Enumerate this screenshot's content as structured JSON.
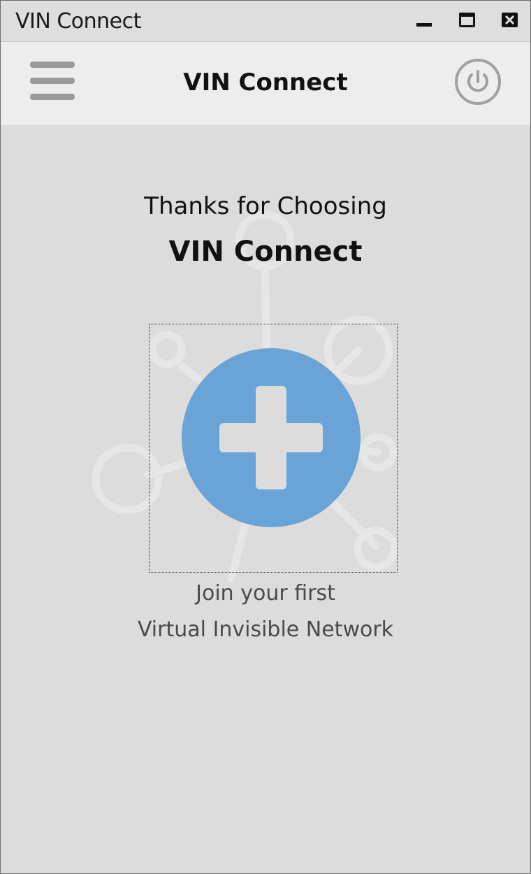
{
  "window": {
    "title": "VIN Connect",
    "controls": {
      "minimize": "minimize-icon",
      "maximize": "maximize-icon",
      "close": "close-icon"
    }
  },
  "header": {
    "title": "VIN Connect",
    "menu_icon": "hamburger-menu-icon",
    "power_icon": "power-icon"
  },
  "main": {
    "greeting": "Thanks for Choosing",
    "brand": "VIN Connect",
    "add_icon": "plus-circle-icon",
    "caption_line1": "Join your first",
    "caption_line2": "Virtual Invisible Network"
  },
  "colors": {
    "accent": "#6aa3d5",
    "background": "#dcdcdc",
    "header_bg": "#ededed",
    "icon_gray": "#9a9a9a"
  }
}
